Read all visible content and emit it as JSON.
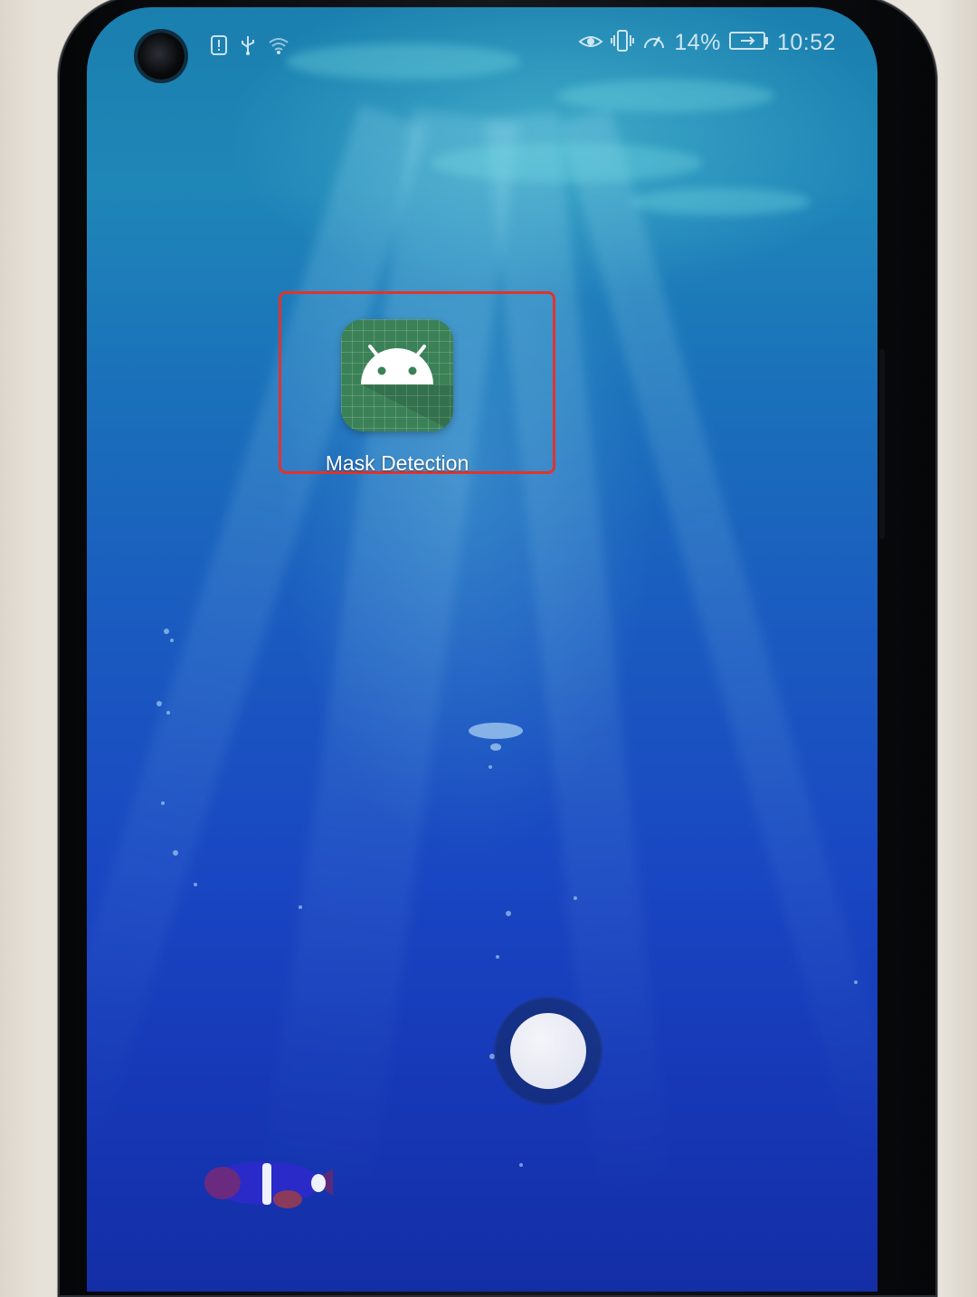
{
  "status_bar": {
    "left_icons": [
      "notification-alert-icon",
      "usb-icon",
      "wifi-icon"
    ],
    "right_icons": [
      "eye-comfort-icon",
      "vibrate-icon",
      "data-speed-icon",
      "battery-icon"
    ],
    "battery_percent": "14%",
    "time": "10:52"
  },
  "home_screen": {
    "apps": [
      {
        "label": "Mask Detection",
        "icon": "android-icon",
        "icon_color": "#3b8157",
        "highlighted": true
      }
    ],
    "highlight_color": "#e2332b",
    "wallpaper": "underwater"
  },
  "floating_button": {
    "icon": "assistive-touch-icon"
  }
}
